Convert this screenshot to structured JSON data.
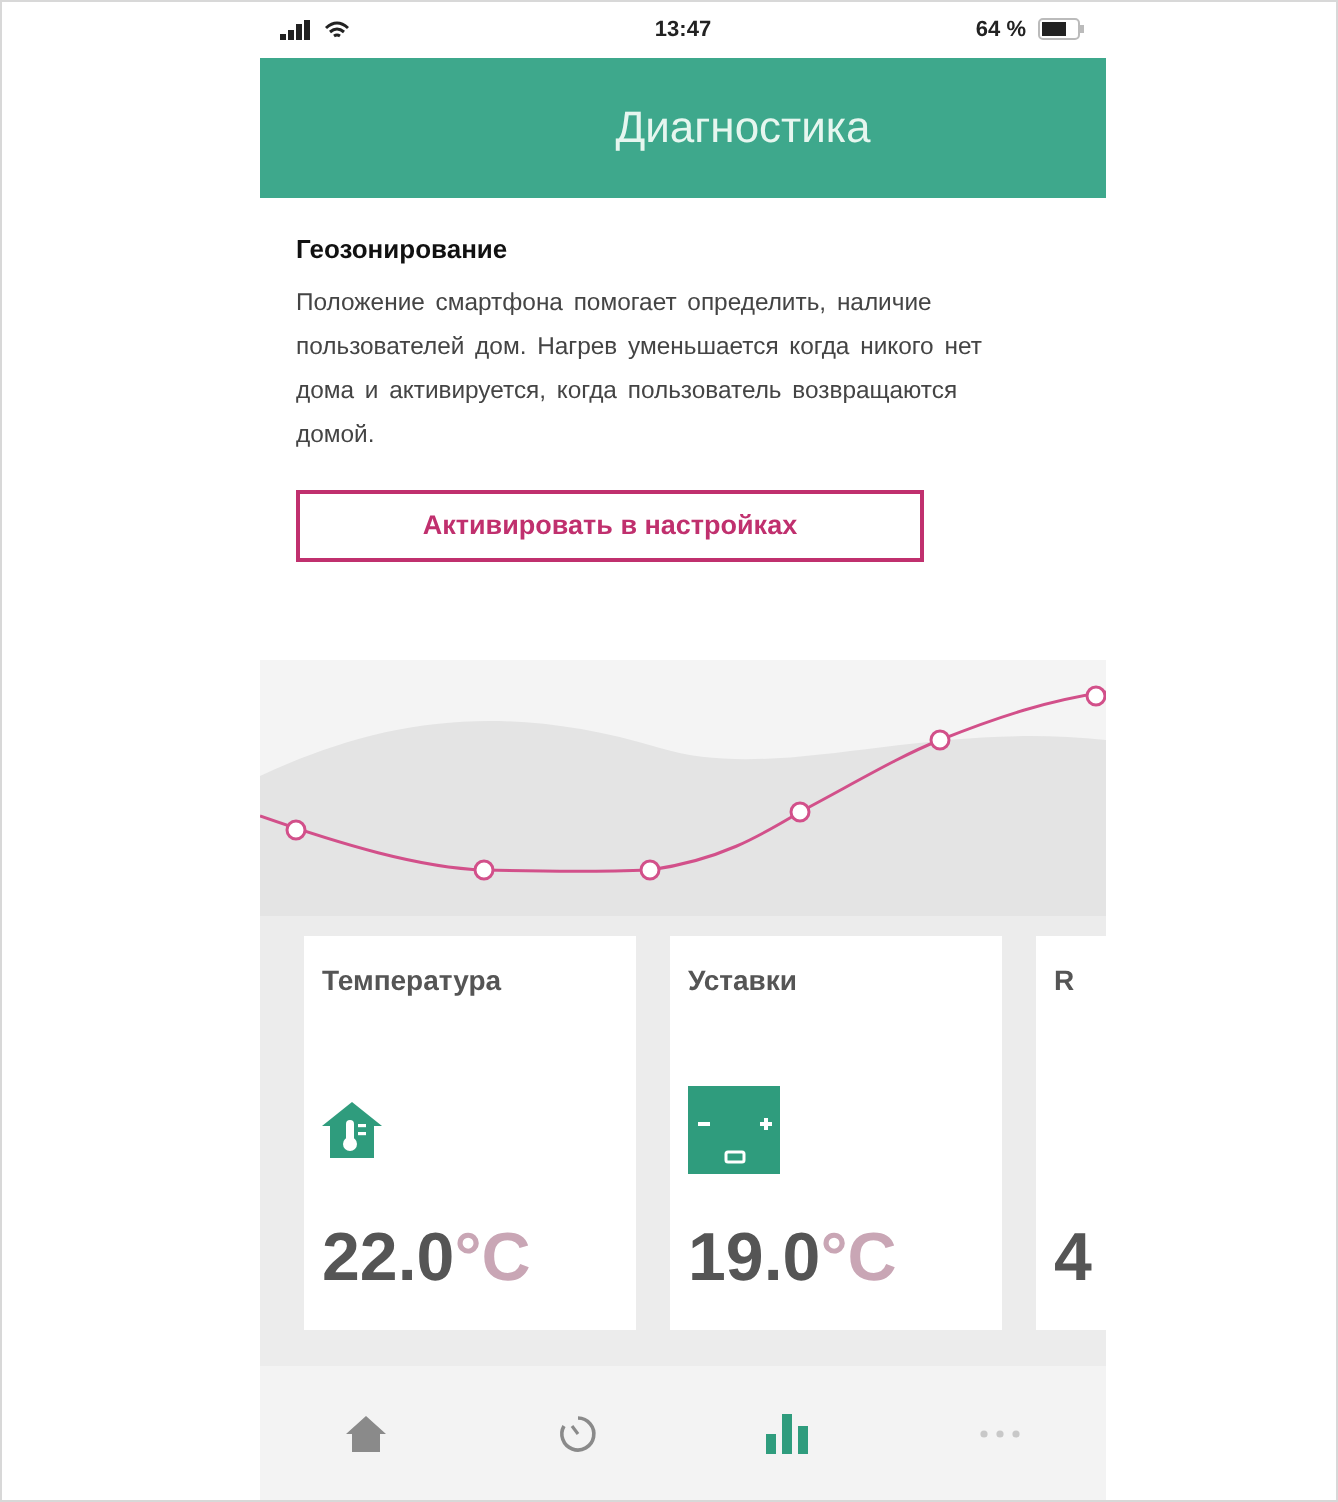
{
  "status_bar": {
    "time": "13:47",
    "battery": "64 %"
  },
  "header": {
    "title": "Диагностика"
  },
  "geofencing": {
    "title": "Геозонирование",
    "text": "Положение смартфона помогает определить, наличие пользователей дом. Нагрев уменьшается когда никого нет дома и активируется, когда пользователь возвращаются домой.",
    "button": "Активировать в настройках"
  },
  "cards": [
    {
      "kind": "temperature",
      "title": "Температура",
      "value": "22.0",
      "unit": "°C"
    },
    {
      "kind": "setpoint",
      "title": "Уставки",
      "value": "19.0",
      "unit": "°C"
    },
    {
      "kind": "other",
      "title": "R",
      "value": "4"
    }
  ],
  "nav": [
    {
      "kind": "home",
      "selected": false
    },
    {
      "kind": "history",
      "selected": false
    },
    {
      "kind": "stats",
      "selected": true
    },
    {
      "kind": "more",
      "selected": false
    }
  ]
}
